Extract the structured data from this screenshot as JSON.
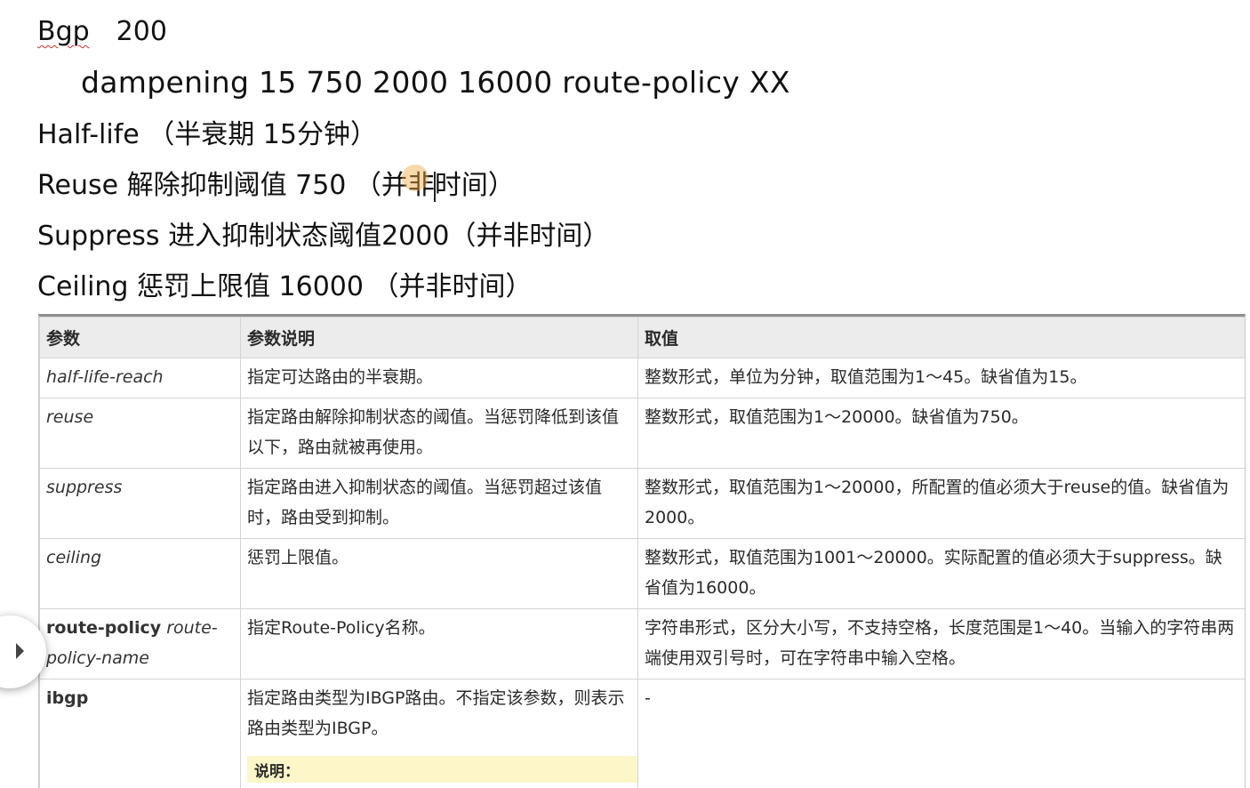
{
  "notes": {
    "line1": {
      "bgp": "Bgp",
      "asn": "200"
    },
    "line2": "dampening 15  750  2000 16000  route-policy XX",
    "line3": "Half-life （半衰期  15分钟）",
    "line4": "Reuse  解除抑制阈值 750 （并非时间）",
    "line5": "Suppress 进入抑制状态阈值2000（并非时间）",
    "line6": "Ceiling  惩罚上限值 16000 （并非时间）"
  },
  "table": {
    "headers": [
      "参数",
      "参数说明",
      "取值"
    ],
    "rows": [
      {
        "param": "half-life-reach",
        "desc": "指定可达路由的半衰期。",
        "value": "整数形式，单位为分钟，取值范围为1～45。缺省值为15。"
      },
      {
        "param": "reuse",
        "desc": "指定路由解除抑制状态的阈值。当惩罚降低到该值以下，路由就被再使用。",
        "value": "整数形式，取值范围为1～20000。缺省值为750。"
      },
      {
        "param": "suppress",
        "desc": "指定路由进入抑制状态的阈值。当惩罚超过该值时，路由受到抑制。",
        "value": "整数形式，取值范围为1～20000，所配置的值必须大于reuse的值。缺省值为2000。"
      },
      {
        "param": "ceiling",
        "desc": "惩罚上限值。",
        "value": "整数形式，取值范围为1001～20000。实际配置的值必须大于suppress。缺省值为16000。"
      },
      {
        "param_bold": "route-policy",
        "param_italic": "route-policy-name",
        "desc": "指定Route-Policy名称。",
        "value": "字符串形式，区分大小写，不支持空格，长度范围是1～40。当输入的字符串两端使用双引号时，可在字符串中输入空格。"
      },
      {
        "param_bold": "ibgp",
        "desc": "指定路由类型为IBGP路由。不指定该参数，则表示路由类型为IBGP。",
        "value": "-",
        "note": "说明："
      }
    ]
  }
}
